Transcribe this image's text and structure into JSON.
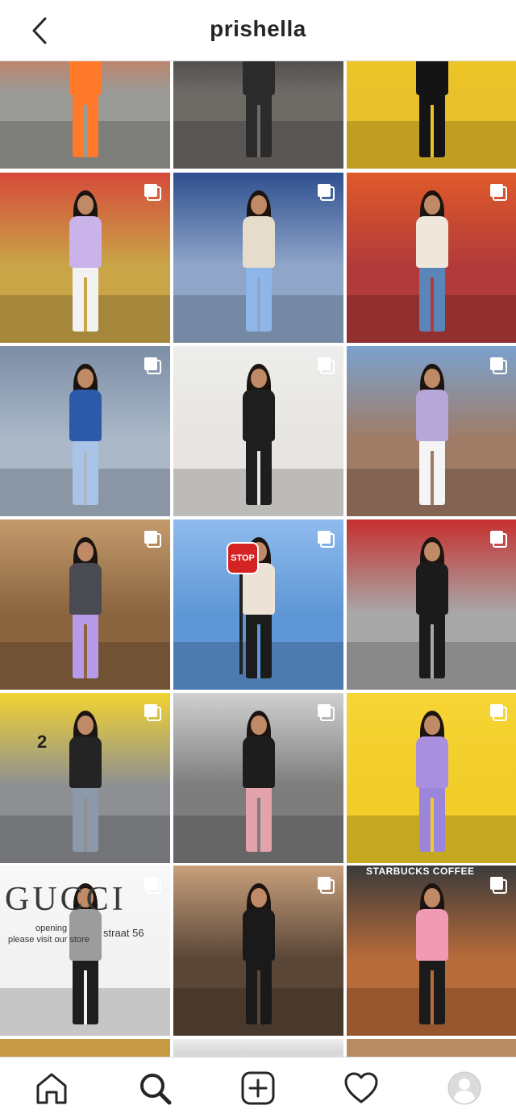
{
  "header": {
    "title": "prishella"
  },
  "tiles": [
    {
      "bg": "#9a9a96",
      "top": "#ff5b1e",
      "outfit": "#ff7a2a",
      "legs": "#ff7a2a",
      "multi": false
    },
    {
      "bg": "#6e6a66",
      "top": "#1d1d1d",
      "outfit": "#2b2b2b",
      "legs": "#2b2b2b",
      "multi": false
    },
    {
      "bg": "#e9c12a",
      "top": "#f4d020",
      "outfit": "#141414",
      "legs": "#141414",
      "multi": false
    },
    {
      "bg": "#c9a548",
      "top": "#d64a3a",
      "outfit": "#c9b3e8",
      "legs": "#f2f2f2",
      "multi": true
    },
    {
      "bg": "#8fa6c9",
      "top": "#2f4f8f",
      "outfit": "#e6dccb",
      "legs": "#8fb6e8",
      "multi": true
    },
    {
      "bg": "#b23a3a",
      "top": "#e05a2a",
      "outfit": "#efe7dc",
      "legs": "#5b84b8",
      "multi": true
    },
    {
      "bg": "#aab8c8",
      "top": "#7c8ea6",
      "outfit": "#2d5aa8",
      "legs": "#a9c4e6",
      "multi": true
    },
    {
      "bg": "#e7e5e1",
      "top": "#ededeb",
      "outfit": "#1e1e1e",
      "legs": "#1e1e1e",
      "multi": true
    },
    {
      "bg": "#a07b66",
      "top": "#7aa2cf",
      "outfit": "#b7a6d8",
      "legs": "#f4f4f4",
      "multi": true
    },
    {
      "bg": "#8a6540",
      "top": "#c49a6c",
      "outfit": "#4a4a52",
      "legs": "#b89be8",
      "multi": true
    },
    {
      "bg": "#5f97d6",
      "top": "#8fbbee",
      "outfit": "#ece2d6",
      "legs": "#1c1c1c",
      "multi": true
    },
    {
      "bg": "#a8a8a8",
      "top": "#c62f2f",
      "outfit": "#1b1b1b",
      "legs": "#1b1b1b",
      "multi": true
    },
    {
      "bg": "#8d8f93",
      "top": "#f2d331",
      "outfit": "#242424",
      "legs": "#8c99ab",
      "multi": true
    },
    {
      "bg": "#7d7d7d",
      "top": "#d0d0d0",
      "outfit": "#1d1d1d",
      "legs": "#e3a2ac",
      "multi": true
    },
    {
      "bg": "#f2cd2a",
      "top": "#f6d534",
      "outfit": "#a98fe0",
      "legs": "#9b86dc",
      "multi": true
    },
    {
      "bg": "#f2f2f2",
      "top": "#f8f8f8",
      "outfit": "#9c9c9c",
      "legs": "#1e1e1e",
      "multi": true
    },
    {
      "bg": "#5a4637",
      "top": "#c8a07c",
      "outfit": "#1a1a1a",
      "legs": "#1a1a1a",
      "multi": true
    },
    {
      "bg": "#b86b3a",
      "top": "#3b3b3b",
      "outfit": "#f09ab4",
      "legs": "#1b1b1b",
      "multi": true
    },
    {
      "bg": "#c79a45",
      "top": "#c79a45",
      "outfit": "#7a5a38",
      "legs": "#7a5a38",
      "multi": false
    },
    {
      "bg": "#d8d8d8",
      "top": "#efefef",
      "outfit": "#999999",
      "legs": "#999999",
      "multi": false
    },
    {
      "bg": "#b98b62",
      "top": "#b98b62",
      "outfit": "#6b4a2e",
      "legs": "#6b4a2e",
      "multi": false
    }
  ],
  "photo_text": {
    "gucci_sign": "GUCCI",
    "gucci_notice_1": "opening",
    "gucci_notice_2": "please visit our store",
    "gucci_notice_3": "straat 56",
    "stop_sign": "STOP",
    "starbucks_sign": "STARBUCKS COFFEE",
    "door_number": "2"
  },
  "tabbar": [
    "home-icon",
    "search-icon",
    "new-post-icon",
    "activity-heart-icon",
    "profile-avatar"
  ]
}
